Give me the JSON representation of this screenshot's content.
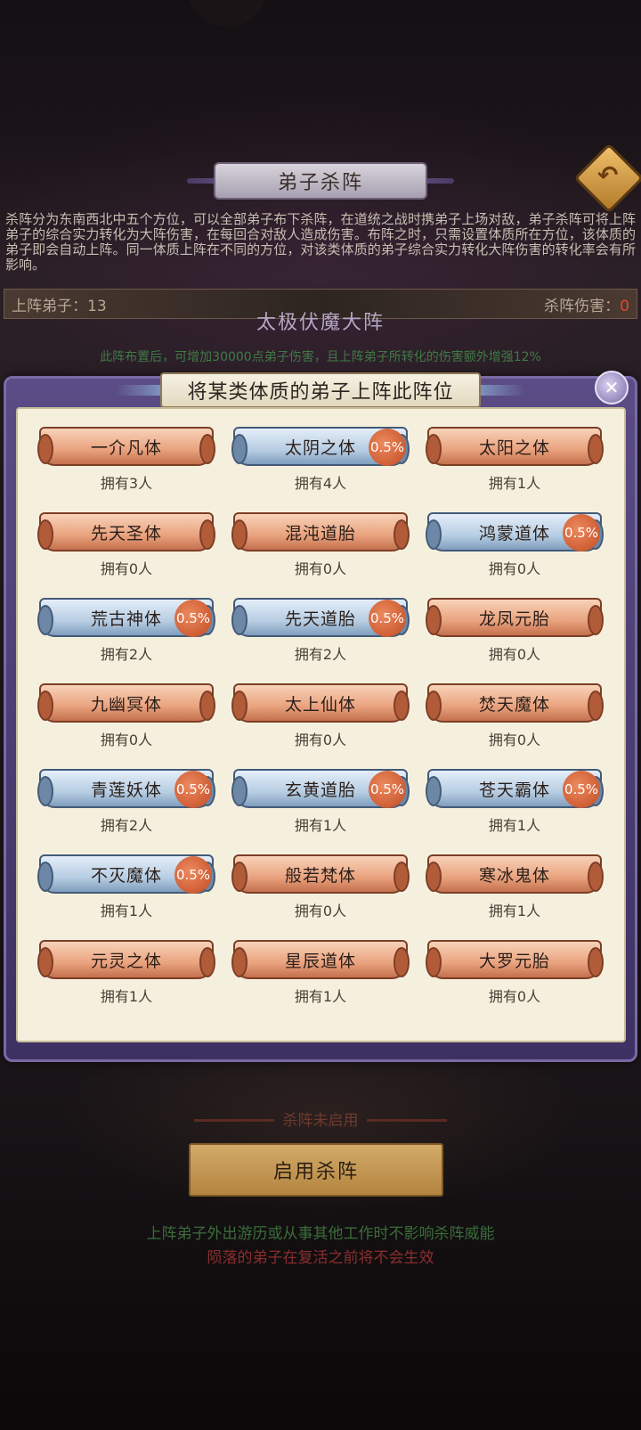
{
  "header": {
    "title": "弟子杀阵",
    "back_icon": "back-arrow-icon"
  },
  "description": "杀阵分为东南西北中五个方位，可以全部弟子布下杀阵，在道统之战时携弟子上场对敌，弟子杀阵可将上阵弟子的综合实力转化为大阵伤害，在每回合对敌人造成伤害。布阵之时，只需设置体质所在方位，该体质的弟子即会自动上阵。同一体质上阵在不同的方位，对该类体质的弟子综合实力转化大阵伤害的转化率会有所影响。",
  "stats": {
    "deployed_label": "上阵弟子：",
    "deployed_value": "13",
    "damage_label": "杀阵伤害：",
    "damage_value": "0"
  },
  "formation": {
    "name": "太极伏魔大阵",
    "tip": "此阵布置后，可增加30000点弟子伤害，且上阵弟子所转化的伤害额外增强12%"
  },
  "modal": {
    "title": "将某类体质的弟子上阵此阵位",
    "close_icon": "close-icon"
  },
  "constitutions": [
    {
      "name": "一介凡体",
      "count": "拥有3人",
      "style": "orange",
      "bonus": ""
    },
    {
      "name": "太阴之体",
      "count": "拥有4人",
      "style": "blue",
      "bonus": "0.5%"
    },
    {
      "name": "太阳之体",
      "count": "拥有1人",
      "style": "orange",
      "bonus": ""
    },
    {
      "name": "先天圣体",
      "count": "拥有0人",
      "style": "orange",
      "bonus": ""
    },
    {
      "name": "混沌道胎",
      "count": "拥有0人",
      "style": "orange",
      "bonus": ""
    },
    {
      "name": "鸿蒙道体",
      "count": "拥有0人",
      "style": "blue",
      "bonus": "0.5%"
    },
    {
      "name": "荒古神体",
      "count": "拥有2人",
      "style": "blue",
      "bonus": "0.5%"
    },
    {
      "name": "先天道胎",
      "count": "拥有2人",
      "style": "blue",
      "bonus": "0.5%"
    },
    {
      "name": "龙凤元胎",
      "count": "拥有0人",
      "style": "orange",
      "bonus": ""
    },
    {
      "name": "九幽冥体",
      "count": "拥有0人",
      "style": "orange",
      "bonus": ""
    },
    {
      "name": "太上仙体",
      "count": "拥有0人",
      "style": "orange",
      "bonus": ""
    },
    {
      "name": "焚天魔体",
      "count": "拥有0人",
      "style": "orange",
      "bonus": ""
    },
    {
      "name": "青莲妖体",
      "count": "拥有2人",
      "style": "blue",
      "bonus": "0.5%"
    },
    {
      "name": "玄黄道胎",
      "count": "拥有1人",
      "style": "blue",
      "bonus": "0.5%"
    },
    {
      "name": "苍天霸体",
      "count": "拥有1人",
      "style": "blue",
      "bonus": "0.5%"
    },
    {
      "name": "不灭魔体",
      "count": "拥有1人",
      "style": "blue",
      "bonus": "0.5%"
    },
    {
      "name": "般若梵体",
      "count": "拥有0人",
      "style": "orange",
      "bonus": ""
    },
    {
      "name": "寒冰鬼体",
      "count": "拥有1人",
      "style": "orange",
      "bonus": ""
    },
    {
      "name": "元灵之体",
      "count": "拥有1人",
      "style": "orange",
      "bonus": ""
    },
    {
      "name": "星辰道体",
      "count": "拥有1人",
      "style": "orange",
      "bonus": ""
    },
    {
      "name": "大罗元胎",
      "count": "拥有0人",
      "style": "orange",
      "bonus": ""
    }
  ],
  "bottom": {
    "status": "杀阵未启用",
    "enable_button": "启用杀阵",
    "note1": "上阵弟子外出游历或从事其他工作时不影响杀阵威能",
    "note2": "陨落的弟子在复活之前将不会生效"
  }
}
